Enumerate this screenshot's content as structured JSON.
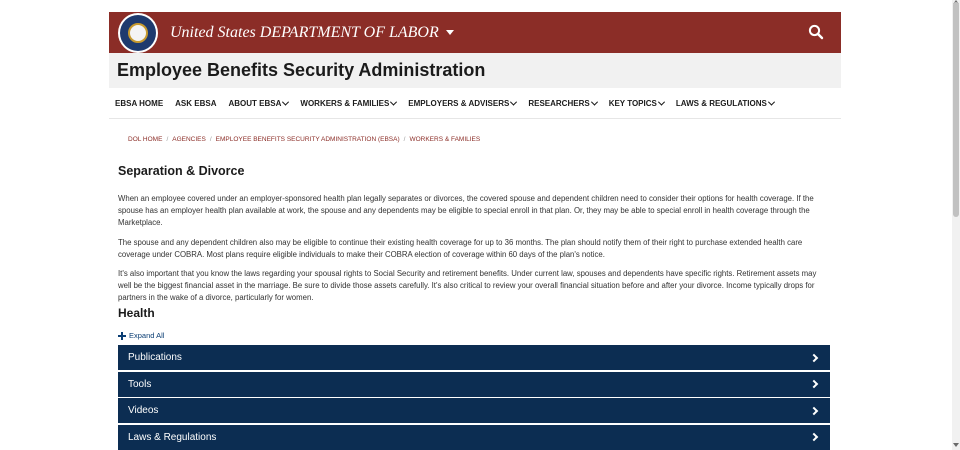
{
  "header": {
    "agency_title": "United States DEPARTMENT OF LABOR",
    "subtitle": "Employee Benefits Security Administration"
  },
  "nav": {
    "items": [
      {
        "label": "EBSA HOME"
      },
      {
        "label": "ASK EBSA"
      },
      {
        "label": "ABOUT EBSA"
      },
      {
        "label": "WORKERS & FAMILIES"
      },
      {
        "label": "EMPLOYERS & ADVISERS"
      },
      {
        "label": "RESEARCHERS"
      },
      {
        "label": "KEY TOPICS"
      },
      {
        "label": "LAWS & REGULATIONS"
      }
    ]
  },
  "breadcrumb": [
    "DOL HOME",
    "AGENCIES",
    "EMPLOYEE BENEFITS SECURITY ADMINISTRATION (EBSA)",
    "WORKERS & FAMILIES"
  ],
  "main": {
    "title": "Separation & Divorce",
    "paragraphs": [
      "When an employee covered under an employer-sponsored health plan legally separates or divorces, the covered spouse and dependent children need to consider their options for health coverage. If the spouse has an employer health plan available at work, the spouse and any dependents may be eligible to special enroll in that plan. Or, they may be able to special enroll in health coverage through the Marketplace.",
      "The spouse and any dependent children also may be eligible to continue their existing health coverage for up to 36 months. The plan should notify them of their right to purchase extended health care coverage under COBRA. Most plans require eligible individuals to make their COBRA election of coverage within 60 days of the plan's notice.",
      "It's also important that you know the laws regarding your spousal rights to Social Security and retirement benefits. Under current law, spouses and dependents have specific rights. Retirement assets may well be the biggest financial asset in the marriage. Be sure to divide those assets carefully. It's also critical to review your overall financial situation before and after your divorce. Income typically drops for partners in the wake of a divorce, particularly for women."
    ],
    "section_heading": "Health",
    "expand_all": "Expand All",
    "accordion": [
      {
        "label": "Publications"
      },
      {
        "label": "Tools"
      },
      {
        "label": "Videos"
      },
      {
        "label": "Laws & Regulations"
      }
    ]
  },
  "colors": {
    "brand_red": "#8b2d27",
    "accordion_navy": "#0c2d52",
    "link_blue": "#0b3e74"
  },
  "icons": {
    "search": "search-icon",
    "seal": "dol-seal-icon",
    "expand": "plus-icon",
    "accordion": "chevron-right-icon",
    "nav": "chevron-down-icon"
  }
}
